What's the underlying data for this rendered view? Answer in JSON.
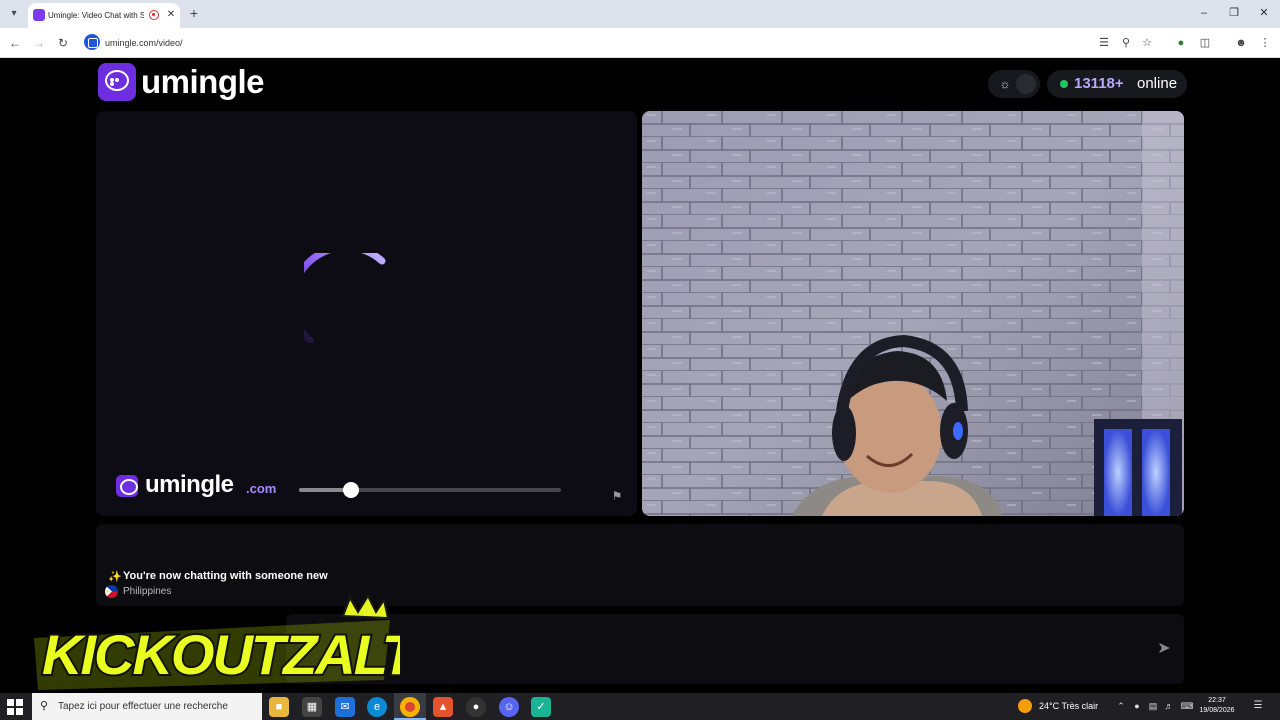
{
  "browser": {
    "tab_title": "Umingle: Video Chat with S",
    "url": "umingle.com/video/",
    "icons": [
      "tab-list-icon",
      "recording-icon",
      "close-icon",
      "new-tab-icon",
      "minimize-icon",
      "restore-icon",
      "close-window-icon",
      "back-icon",
      "forward-icon",
      "reload-icon",
      "translate-icon",
      "zoom-icon",
      "bookmark-star-icon",
      "extension-icon",
      "puzzle-icon",
      "profile-icon",
      "menu-icon"
    ]
  },
  "header": {
    "logo_text": "umingle",
    "online_count": "13118+",
    "online_label": "online"
  },
  "left_video": {
    "watermark_text": "umingle",
    "watermark_suffix": ".com",
    "volume": 0.2
  },
  "chat": {
    "system_message": "You're now chatting with someone new",
    "country": "Philippines"
  },
  "input": {
    "placeholder": ""
  },
  "overlay": {
    "brand": "KICKOUTZALT"
  },
  "taskbar": {
    "search_placeholder": "Tapez ici pour effectuer une recherche",
    "weather": "24°C  Très clair",
    "time": "22:37",
    "date": "19/08/2026"
  },
  "colors": {
    "brand_purple": "#6d2ee0",
    "online_green": "#22c55e",
    "count_lavender": "#b9a7ff"
  }
}
